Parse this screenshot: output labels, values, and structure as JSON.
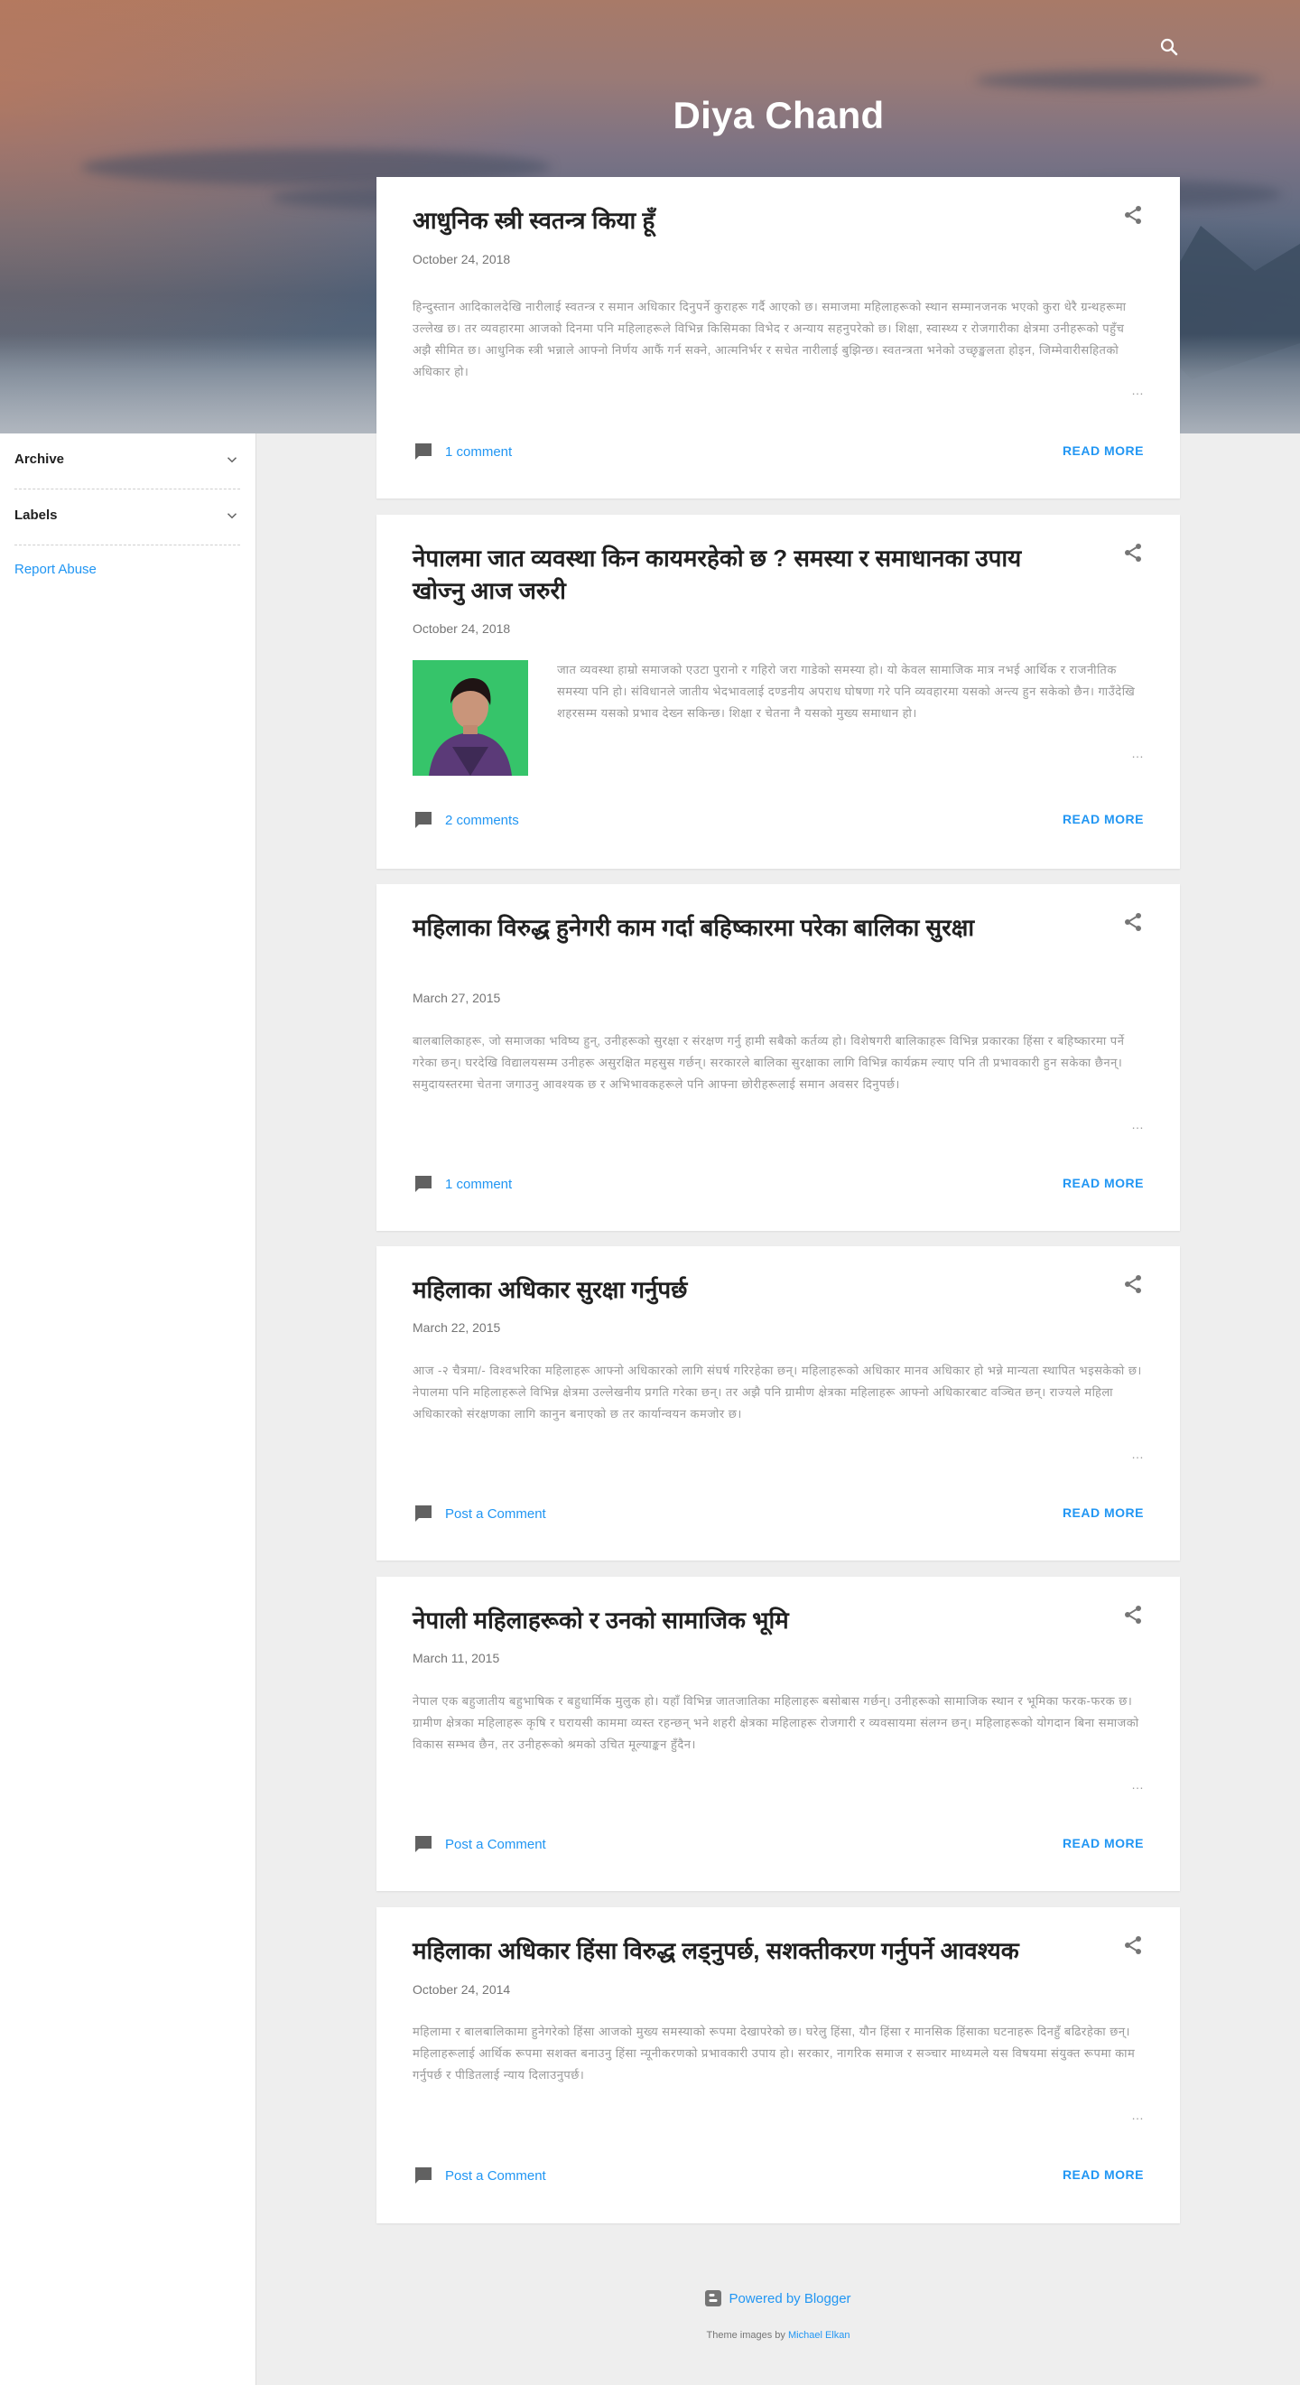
{
  "blog": {
    "title": "Diya Chand"
  },
  "icons": {
    "search": "search-icon",
    "share": "share-icon",
    "comment": "comment-icon",
    "chevron": "chevron-down-icon",
    "blogger": "blogger-icon"
  },
  "colors": {
    "link": "#2196f3",
    "thumbnail_background": "#34c266"
  },
  "sidebar": {
    "archive_label": "Archive",
    "labels_label": "Labels",
    "report_abuse": "Report Abuse"
  },
  "posts": [
    {
      "title": "आधुनिक स्त्री स्वतन्त्र किया हूँ",
      "date": "October 24, 2018",
      "snippet": "हिन्दुस्तान आदिकालदेखि नारीलाई स्वतन्त्र र समान अधिकार दिनुपर्ने कुराहरू गर्दै आएको छ। समाजमा महिलाहरूको स्थान सम्मानजनक भएको कुरा धेरै ग्रन्थहरूमा उल्लेख छ। तर व्यवहारमा आजको दिनमा पनि महिलाहरूले विभिन्न किसिमका विभेद र अन्याय सहनुपरेको छ। शिक्षा, स्वास्थ्य र रोजगारीका क्षेत्रमा उनीहरूको पहुँच अझै सीमित छ। आधुनिक स्त्री भन्नाले आफ्नो निर्णय आफैं गर्न सक्ने, आत्मनिर्भर र सचेत नारीलाई बुझिन्छ। स्वतन्त्रता भनेको उच्छृङ्खलता होइन, जिम्मेवारीसहितको अधिकार हो।",
      "comments": "1 comment",
      "read_more": "READ MORE",
      "ellipsis": "…",
      "has_thumbnail": false
    },
    {
      "title": "नेपालमा जात व्यवस्था किन कायमरहेको छ ? समस्या र समाधानका उपाय खोज्नु आज जरुरी",
      "date": "October 24, 2018",
      "snippet": "जात व्यवस्था हाम्रो समाजको एउटा पुरानो र गहिरो जरा गाडेको समस्या हो। यो केवल सामाजिक मात्र नभई आर्थिक र राजनीतिक समस्या पनि हो। संविधानले जातीय भेदभावलाई दण्डनीय अपराध घोषणा गरे पनि व्यवहारमा यसको अन्त्य हुन सकेको छैन। गाउँदेखि शहरसम्म यसको प्रभाव देख्न सकिन्छ। शिक्षा र चेतना नै यसको मुख्य समाधान हो।",
      "comments": "2 comments",
      "read_more": "READ MORE",
      "ellipsis": "…",
      "has_thumbnail": true
    },
    {
      "title": "महिलाका विरुद्ध हुनेगरी काम गर्दा बहिष्कारमा परेका बालिका सुरक्षा",
      "date": "March 27, 2015",
      "snippet": "बालबालिकाहरू, जो समाजका भविष्य हुन्, उनीहरूको सुरक्षा र संरक्षण गर्नु हामी सबैको कर्तव्य हो। विशेषगरी बालिकाहरू विभिन्न प्रकारका हिंसा र बहिष्कारमा पर्ने गरेका छन्। घरदेखि विद्यालयसम्म उनीहरू असुरक्षित महसुस गर्छन्। सरकारले बालिका सुरक्षाका लागि विभिन्न कार्यक्रम ल्याए पनि ती प्रभावकारी हुन सकेका छैनन्। समुदायस्तरमा चेतना जगाउनु आवश्यक छ र अभिभावकहरूले पनि आफ्ना छोरीहरूलाई समान अवसर दिनुपर्छ।",
      "comments": "1 comment",
      "read_more": "READ MORE",
      "ellipsis": "…",
      "has_thumbnail": false
    },
    {
      "title": "महिलाका अधिकार सुरक्षा गर्नुपर्छ",
      "date": "March 22, 2015",
      "snippet": "आज -२ चैत्रमा/- विश्वभरिका महिलाहरू आफ्नो अधिकारको लागि संघर्ष गरिरहेका छन्। महिलाहरूको अधिकार मानव अधिकार हो भन्ने मान्यता स्थापित भइसकेको छ। नेपालमा पनि महिलाहरूले विभिन्न क्षेत्रमा उल्लेखनीय प्रगति गरेका छन्। तर अझै पनि ग्रामीण क्षेत्रका महिलाहरू आफ्नो अधिकारबाट वञ्चित छन्। राज्यले महिला अधिकारको संरक्षणका लागि कानुन बनाएको छ तर कार्यान्वयन कमजोर छ।",
      "comments": "Post a Comment",
      "read_more": "READ MORE",
      "ellipsis": "…",
      "has_thumbnail": false
    },
    {
      "title": "नेपाली महिलाहरूको र उनको सामाजिक भूमि",
      "date": "March 11, 2015",
      "snippet": "नेपाल एक बहुजातीय बहुभाषिक र बहुधार्मिक मुलुक हो। यहाँ विभिन्न जातजातिका महिलाहरू बसोबास गर्छन्। उनीहरूको सामाजिक स्थान र भूमिका फरक-फरक छ। ग्रामीण क्षेत्रका महिलाहरू कृषि र घरायसी काममा व्यस्त रहन्छन् भने शहरी क्षेत्रका महिलाहरू रोजगारी र व्यवसायमा संलग्न छन्। महिलाहरूको योगदान बिना समाजको विकास सम्भव छैन, तर उनीहरूको श्रमको उचित मूल्याङ्कन हुँदैन।",
      "comments": "Post a Comment",
      "read_more": "READ MORE",
      "ellipsis": "…",
      "has_thumbnail": false
    },
    {
      "title": "महिलाका अधिकार हिंसा विरुद्ध लड्नुपर्छ, सशक्तीकरण गर्नुपर्ने आवश्यक",
      "date": "October 24, 2014",
      "snippet": "महिलामा र बालबालिकामा हुनेगरेको हिंसा आजको मुख्य समस्याको रूपमा देखापरेको छ। घरेलु हिंसा, यौन हिंसा र मानसिक हिंसाका घटनाहरू दिनहुँ बढिरहेका छन्। महिलाहरूलाई आर्थिक रूपमा सशक्त बनाउनु हिंसा न्यूनीकरणको प्रभावकारी उपाय हो। सरकार, नागरिक समाज र सञ्चार माध्यमले यस विषयमा संयुक्त रूपमा काम गर्नुपर्छ र पीडितलाई न्याय दिलाउनुपर्छ।",
      "comments": "Post a Comment",
      "read_more": "READ MORE",
      "ellipsis": "…",
      "has_thumbnail": false
    }
  ],
  "footer": {
    "powered_by": "Powered by Blogger",
    "theme_credit_prefix": "Theme images by",
    "theme_credit_author": "Michael Elkan"
  }
}
